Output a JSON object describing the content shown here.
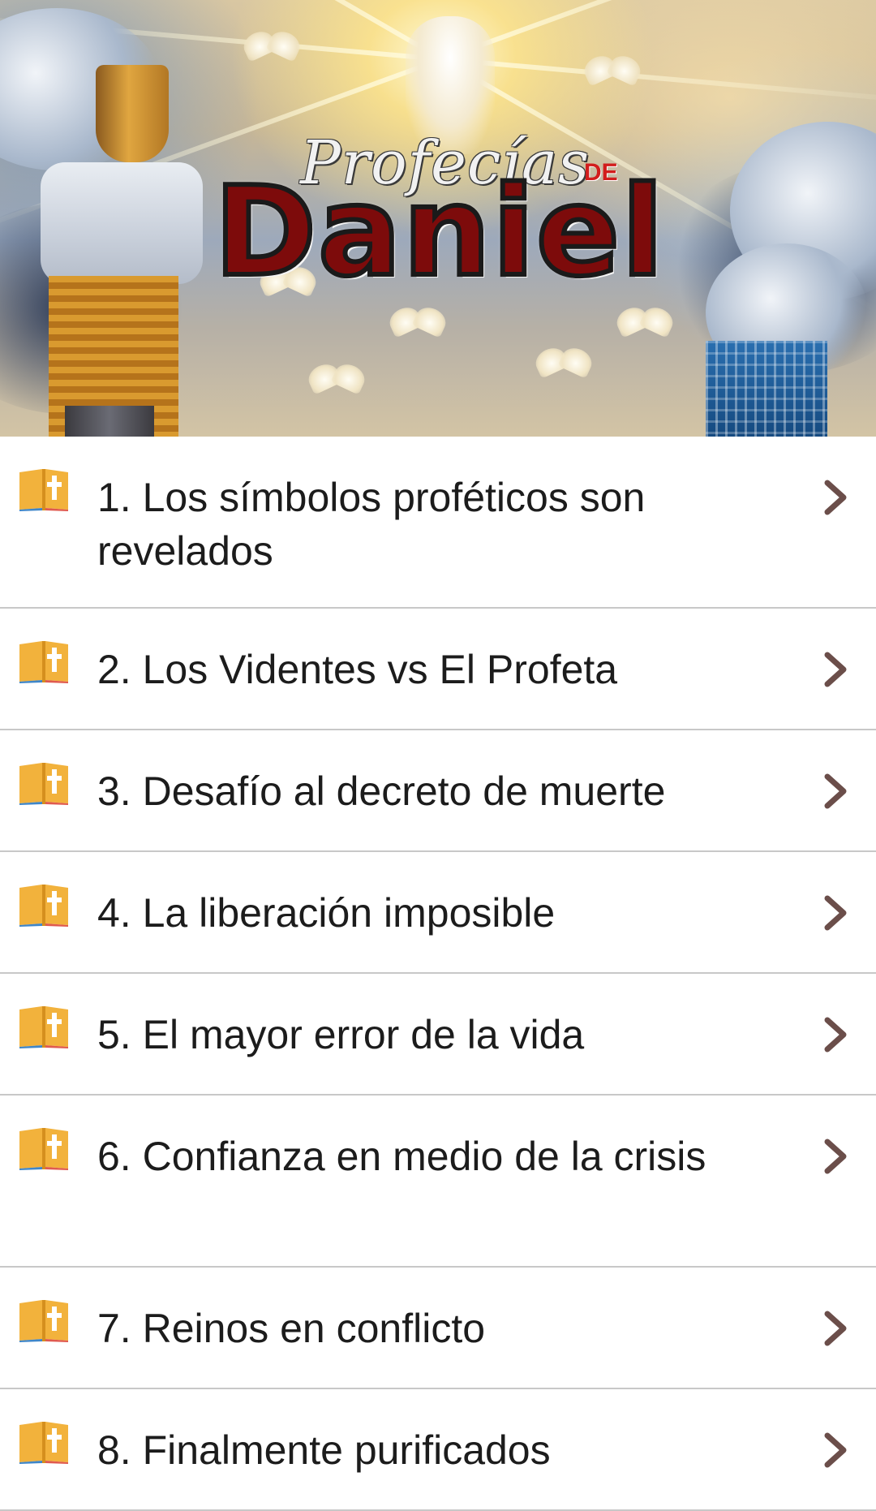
{
  "banner": {
    "title_script": "Profecías",
    "title_de": "DE",
    "title_main": "Daniel"
  },
  "colors": {
    "title_red": "#7d0b0b",
    "de_red": "#d21d1d",
    "chevron": "#6b4e4a",
    "divider": "#c8c8c8",
    "book_orange": "#f2b23c",
    "book_blue": "#3f86c9",
    "book_red": "#e05a4f"
  },
  "list": {
    "icon": "bible-icon",
    "trailing_icon": "chevron-right-icon",
    "items": [
      {
        "label": "1. Los símbolos proféticos son revelados"
      },
      {
        "label": "2. Los Videntes vs El Profeta"
      },
      {
        "label": "3. Desafío al decreto de muerte"
      },
      {
        "label": "4. La liberación imposible"
      },
      {
        "label": "5. El mayor error de la vida"
      },
      {
        "label": "6. Confianza en medio de la crisis"
      },
      {
        "label": "7. Reinos en conflicto"
      },
      {
        "label": "8. Finalmente purificados"
      }
    ]
  }
}
